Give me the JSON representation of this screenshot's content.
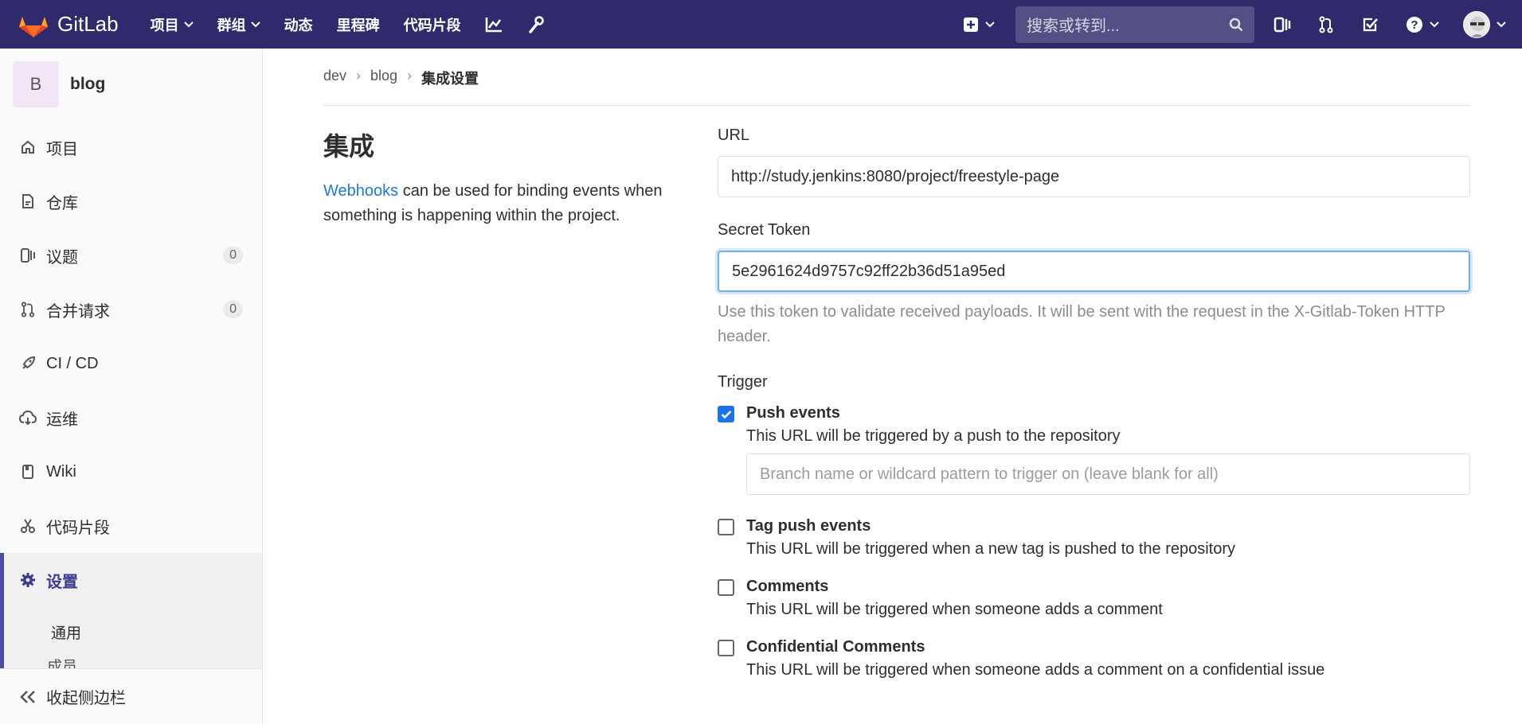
{
  "navbar": {
    "brand": "GitLab",
    "links": [
      {
        "label": "项目",
        "dropdown": true
      },
      {
        "label": "群组",
        "dropdown": true
      },
      {
        "label": "动态",
        "dropdown": false
      },
      {
        "label": "里程碑",
        "dropdown": false
      },
      {
        "label": "代码片段",
        "dropdown": false
      }
    ],
    "icons": [
      "chart-icon",
      "wrench-icon"
    ],
    "search_placeholder": "搜索或转到...",
    "right_icons": [
      "issues-icon",
      "merge-request-icon",
      "todo-icon",
      "help-icon"
    ],
    "colors": {
      "bg": "#2f2a6b",
      "logo_orange": "#e24329"
    }
  },
  "sidebar": {
    "project_initial": "B",
    "project_name": "blog",
    "items": [
      {
        "label": "项目",
        "icon": "home-icon"
      },
      {
        "label": "仓库",
        "icon": "repository-icon"
      },
      {
        "label": "议题",
        "icon": "issues-icon",
        "count": "0"
      },
      {
        "label": "合并请求",
        "icon": "merge-request-icon",
        "count": "0"
      },
      {
        "label": "CI / CD",
        "icon": "rocket-icon"
      },
      {
        "label": "运维",
        "icon": "cloud-icon"
      },
      {
        "label": "Wiki",
        "icon": "book-icon"
      },
      {
        "label": "代码片段",
        "icon": "scissors-icon"
      },
      {
        "label": "设置",
        "icon": "gear-icon",
        "active": true
      }
    ],
    "sub_items": [
      "通用",
      "成员"
    ],
    "collapse_label": "收起侧边栏"
  },
  "breadcrumb": [
    "dev",
    "blog",
    "集成设置"
  ],
  "section": {
    "title": "集成",
    "desc_link": "Webhooks",
    "desc_rest": " can be used for binding events when something is happening within the project."
  },
  "form": {
    "url_label": "URL",
    "url_value": "http://study.jenkins:8080/project/freestyle-page",
    "token_label": "Secret Token",
    "token_value": "5e2961624d9757c92ff22b36d51a95ed",
    "token_help": "Use this token to validate received payloads. It will be sent with the request in the X-Gitlab-Token HTTP header.",
    "trigger_label": "Trigger",
    "triggers": [
      {
        "title": "Push events",
        "desc": "This URL will be triggered by a push to the repository",
        "checked": true,
        "branch_placeholder": "Branch name or wildcard pattern to trigger on (leave blank for all)"
      },
      {
        "title": "Tag push events",
        "desc": "This URL will be triggered when a new tag is pushed to the repository",
        "checked": false
      },
      {
        "title": "Comments",
        "desc": "This URL will be triggered when someone adds a comment",
        "checked": false
      },
      {
        "title": "Confidential Comments",
        "desc": "This URL will be triggered when someone adds a comment on a confidential issue",
        "checked": false
      }
    ]
  }
}
